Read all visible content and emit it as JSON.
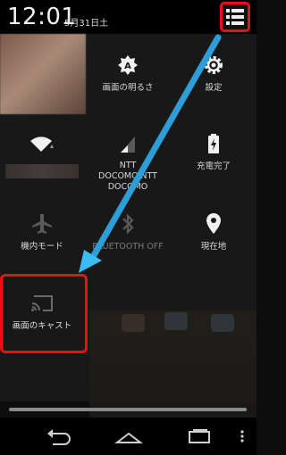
{
  "status_bar": {
    "time": "12:01",
    "date": "5月31日土"
  },
  "quick_settings": {
    "tiles": [
      {
        "id": "user",
        "label": ""
      },
      {
        "id": "brightness",
        "label": "画面の明るさ"
      },
      {
        "id": "settings",
        "label": "設定"
      },
      {
        "id": "wifi",
        "label": ""
      },
      {
        "id": "mobile-network",
        "label": "NTT DOCOMOINTT DOCOMO"
      },
      {
        "id": "battery",
        "label": "充電完了"
      },
      {
        "id": "airplane-mode",
        "label": "機内モード"
      },
      {
        "id": "bluetooth",
        "label": "BLUETOOTH OFF"
      },
      {
        "id": "location",
        "label": "現在地"
      },
      {
        "id": "cast-screen",
        "label": "画面のキャスト"
      }
    ]
  },
  "colors": {
    "highlight": "#e8101a",
    "arrow": "#29a3e0",
    "panel": "#181818"
  },
  "navigation": {
    "icons": [
      "back-icon",
      "home-icon",
      "recent-apps-icon",
      "menu-icon"
    ]
  }
}
